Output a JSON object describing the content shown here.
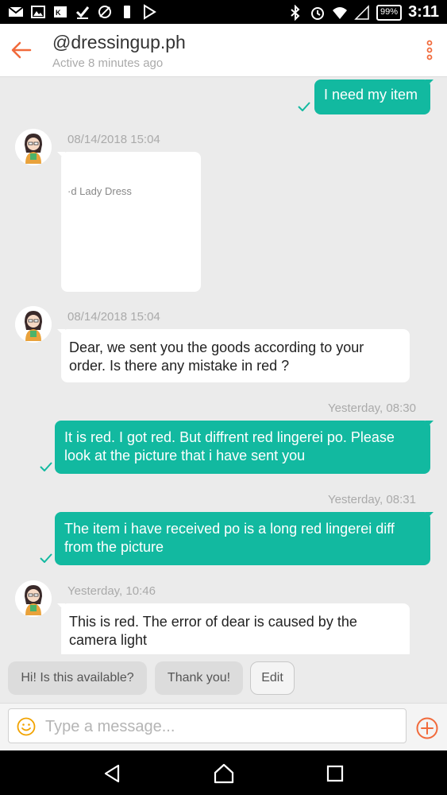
{
  "status_bar": {
    "battery": "99%",
    "time": "3:11",
    "left_icons": [
      "mail-icon",
      "image-icon",
      "news-icon",
      "check-icon",
      "no-signal-icon",
      "phone-icon",
      "play-store-icon"
    ],
    "right_icons": [
      "bluetooth-icon",
      "alarm-icon",
      "wifi-icon",
      "signal-icon"
    ]
  },
  "header": {
    "title": "@dressingup.ph",
    "subtitle": "Active 8 minutes ago"
  },
  "messages": [
    {
      "dir": "out",
      "text": "I need my item",
      "read": true
    },
    {
      "dir": "in",
      "time": "08/14/2018 15:04",
      "type": "product-card",
      "product_name": "·d Lady Dress"
    },
    {
      "dir": "in",
      "time": "08/14/2018 15:04",
      "text": "Dear, we sent you the goods according to your order. Is there any mistake in red ?"
    },
    {
      "dir": "out",
      "time": "Yesterday, 08:30",
      "text": "It is red. I got red. But diffrent red lingerei po. Please look at the picture that i have sent you",
      "read": true
    },
    {
      "dir": "out",
      "time": "Yesterday, 08:31",
      "text": "The item i have received po is a long red lingerei diff from the picture",
      "read": true
    },
    {
      "dir": "in",
      "time": "Yesterday, 10:46",
      "text": "This is red. The error of dear is caused by the camera light"
    }
  ],
  "quick_replies": [
    "Hi! Is this available?",
    "Thank you!",
    "Edit"
  ],
  "composer": {
    "placeholder": "Type a message..."
  },
  "colors": {
    "accent": "#f16a3b",
    "outgoing_bubble": "#12b9a0",
    "emoji": "#f2a300"
  }
}
